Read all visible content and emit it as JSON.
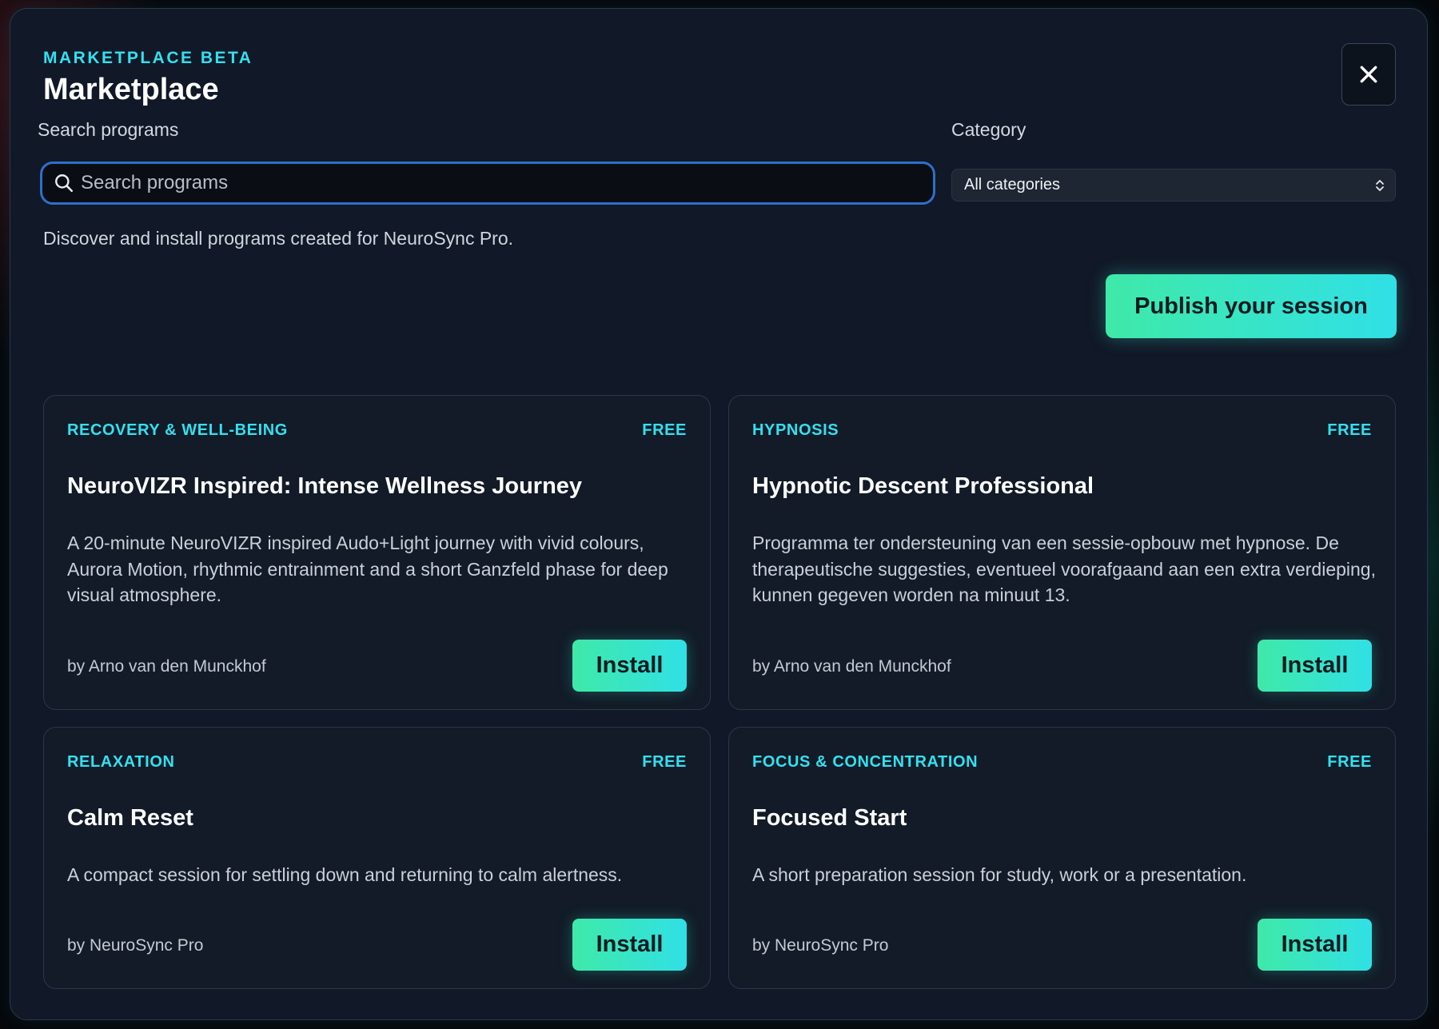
{
  "header": {
    "eyebrow": "MARKETPLACE BETA",
    "title": "Marketplace"
  },
  "search": {
    "label": "Search programs",
    "placeholder": "Search programs",
    "value": ""
  },
  "category": {
    "label": "Category",
    "selected": "All categories"
  },
  "description": "Discover and install programs created for NeuroSync Pro.",
  "publish_label": "Publish your session",
  "cards": [
    {
      "category": "RECOVERY & WELL-BEING",
      "price": "FREE",
      "title": "NeuroVIZR Inspired: Intense Wellness Journey",
      "description": "A 20-minute NeuroVIZR inspired Audo+Light journey with vivid colours, Aurora Motion, rhythmic entrainment and a short Ganzfeld phase for deep visual atmosphere.",
      "author": "by Arno van den Munckhof",
      "install_label": "Install"
    },
    {
      "category": "HYPNOSIS",
      "price": "FREE",
      "title": "Hypnotic Descent Professional",
      "description": "Programma ter ondersteuning van een sessie-opbouw met hypnose. De therapeutische suggesties, eventueel voorafgaand aan een extra verdieping, kunnen gegeven worden na minuut 13.",
      "author": "by Arno van den Munckhof",
      "install_label": "Install"
    },
    {
      "category": "RELAXATION",
      "price": "FREE",
      "title": "Calm Reset",
      "description": "A compact session for settling down and returning to calm alertness.",
      "author": "by NeuroSync Pro",
      "install_label": "Install"
    },
    {
      "category": "FOCUS & CONCENTRATION",
      "price": "FREE",
      "title": "Focused Start",
      "description": "A short preparation session for study, work or a presentation.",
      "author": "by NeuroSync Pro",
      "install_label": "Install"
    }
  ],
  "colors": {
    "accent": "#34e0f0",
    "button_gradient_start": "#3fe9a8",
    "button_gradient_end": "#30e0e6",
    "panel": "#111827",
    "card": "#121b27",
    "focus_ring": "#2f6fc9"
  },
  "icons": {
    "close": "close-icon",
    "search": "search-icon",
    "select": "chevron-up-down-icon"
  }
}
